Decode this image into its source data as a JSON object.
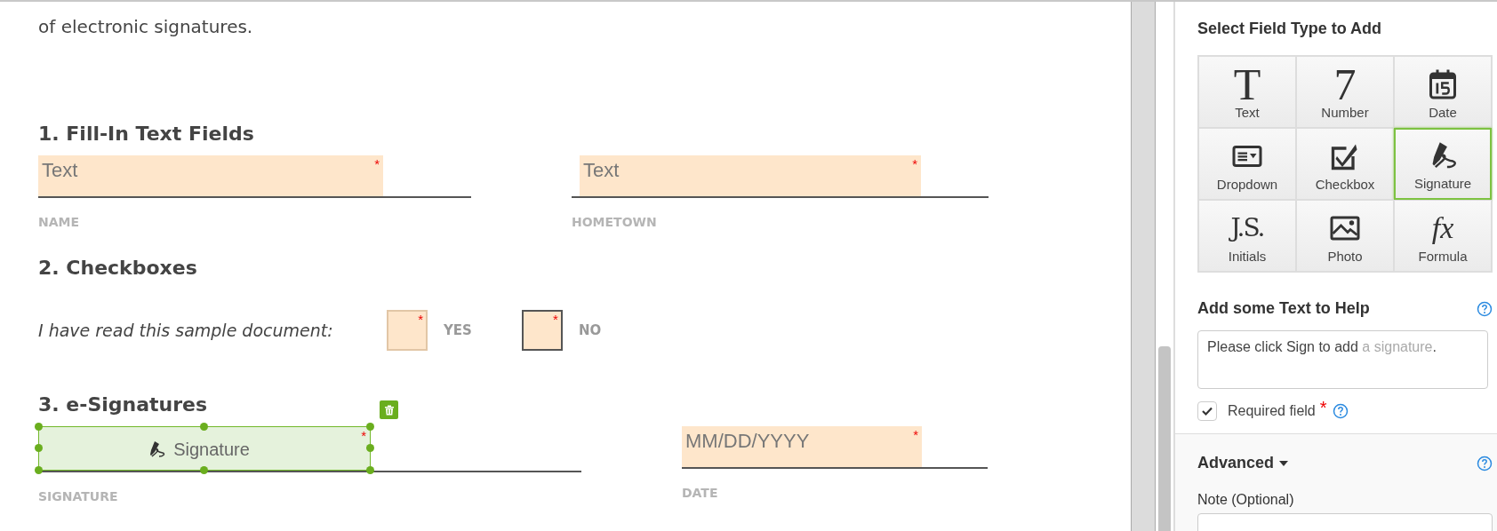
{
  "document": {
    "intro": "of electronic signatures.",
    "sections": [
      {
        "kind": "fields",
        "heading": "1. Fill-In Text Fields",
        "fields": [
          {
            "kind": "text",
            "placeholder": "Text",
            "required_mark": "*",
            "label": "NAME",
            "selected": false
          },
          {
            "kind": "text",
            "placeholder": "Text",
            "required_mark": "*",
            "label": "HOMETOWN",
            "selected": false
          }
        ]
      },
      {
        "kind": "checkboxes",
        "heading": "2. Checkboxes",
        "question": "I have read this sample document:",
        "options": [
          {
            "label": "YES",
            "required_mark": "*",
            "checked": false,
            "focused": false
          },
          {
            "label": "NO",
            "required_mark": "*",
            "checked": false,
            "focused": true
          }
        ]
      },
      {
        "kind": "fields",
        "heading": "3. e-Signatures",
        "fields": [
          {
            "kind": "signature",
            "placeholder": "Signature",
            "required_mark": "*",
            "label": "SIGNATURE",
            "selected": true
          },
          {
            "kind": "date",
            "placeholder": "MM/DD/YYYY",
            "required_mark": "*",
            "label": "DATE",
            "selected": false
          }
        ]
      }
    ]
  },
  "panel": {
    "title": "Select Field Type to Add",
    "field_types": [
      {
        "kind": "glyph",
        "glyph": "T",
        "label": "Text",
        "selected": false
      },
      {
        "kind": "glyph",
        "glyph": "7",
        "label": "Number",
        "selected": false
      },
      {
        "kind": "date",
        "label": "Date",
        "selected": false
      },
      {
        "kind": "dropdown",
        "label": "Dropdown",
        "selected": false
      },
      {
        "kind": "checkbox",
        "label": "Checkbox",
        "selected": false
      },
      {
        "kind": "signature",
        "label": "Signature",
        "selected": true
      },
      {
        "kind": "initials",
        "glyph": "J.S.",
        "label": "Initials",
        "selected": false
      },
      {
        "kind": "photo",
        "label": "Photo",
        "selected": false
      },
      {
        "kind": "formula",
        "glyph": "fx",
        "label": "Formula",
        "selected": false
      }
    ],
    "help": {
      "heading": "Add some Text to Help",
      "value_parts": [
        {
          "text": "Please click Sign to add ",
          "muted": false
        },
        {
          "text": "a signature",
          "muted": true
        },
        {
          "text": ".",
          "muted": false
        }
      ]
    },
    "required": {
      "label": "Required field",
      "mark": "*",
      "checked": true
    },
    "advanced": {
      "heading": "Advanced",
      "expanded": true,
      "note_label": "Note (Optional)"
    }
  }
}
